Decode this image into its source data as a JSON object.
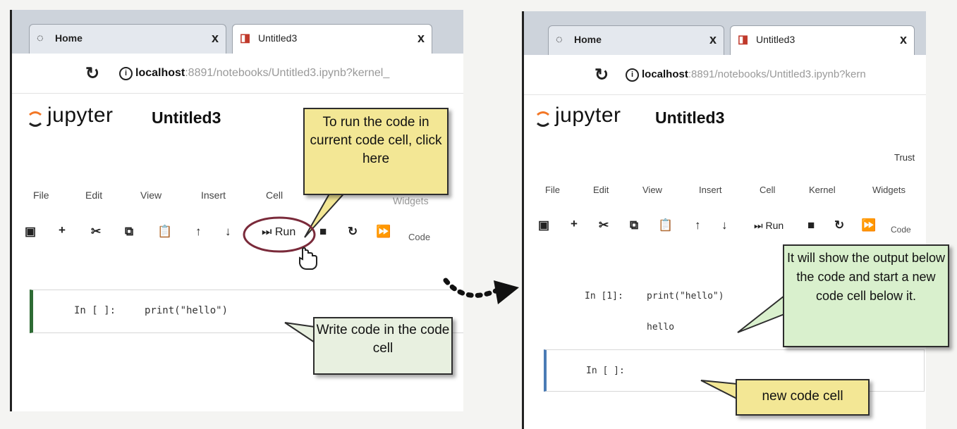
{
  "left": {
    "tabs": [
      {
        "label": "Home",
        "close": "x"
      },
      {
        "label": "Untitled3",
        "close": "x"
      }
    ],
    "address": {
      "host": "localhost",
      "path": ":8891/notebooks/Untitled3.ipynb?kernel_"
    },
    "logo": "jupyter",
    "notebook_title": "Untitled3",
    "menu": [
      "File",
      "Edit",
      "View",
      "Insert",
      "Cell",
      "Widgets"
    ],
    "toolbar": {
      "run_label": "Run",
      "cell_type": "Code"
    },
    "cell": {
      "prompt": "In [ ]:",
      "code": "print(\"hello\")"
    },
    "callout_run": "To run the code in current code cell, click here",
    "callout_write": "Write code in the code cell"
  },
  "right": {
    "tabs": [
      {
        "label": "Home",
        "close": "x"
      },
      {
        "label": "Untitled3",
        "close": "x"
      }
    ],
    "address": {
      "host": "localhost",
      "path": ":8891/notebooks/Untitled3.ipynb?kern"
    },
    "logo": "jupyter",
    "notebook_title": "Untitled3",
    "trusted": "Trust",
    "menu": [
      "File",
      "Edit",
      "View",
      "Insert",
      "Cell",
      "Kernel",
      "Widgets"
    ],
    "toolbar": {
      "run_label": "Run",
      "cell_type": "Code"
    },
    "executed_cell": {
      "prompt": "In [1]:",
      "code": "print(\"hello\")",
      "output": "hello"
    },
    "new_cell": {
      "prompt": "In [ ]:"
    },
    "callout_output": "It will show the output below the code and start a new code cell below it.",
    "callout_newcell": "new code cell"
  },
  "colors": {
    "callout_yellow": "#f3e795",
    "callout_green": "#d9f0cd",
    "highlight_circle": "#7a2a3a",
    "active_cell_border": "#2e6b34",
    "new_cell_border": "#4a7bb5"
  }
}
